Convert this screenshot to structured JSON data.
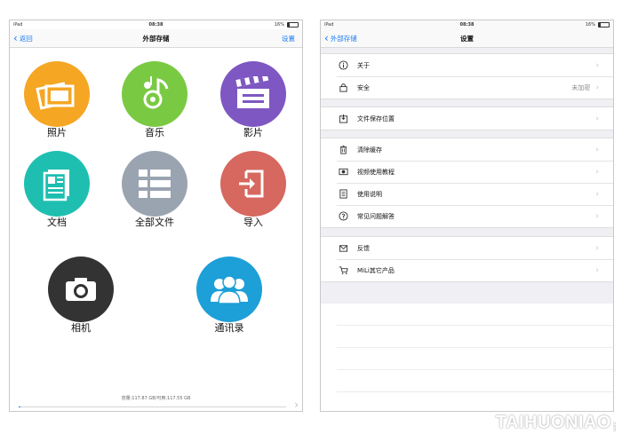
{
  "left": {
    "status": {
      "carrier": "iPad",
      "time": "08:38",
      "battery": "16%"
    },
    "nav": {
      "back": "返回",
      "title": "外部存储",
      "right": "设置"
    },
    "tiles": [
      {
        "label": "照片",
        "icon": "photos-icon",
        "color": "#f5a623"
      },
      {
        "label": "音乐",
        "icon": "music-icon",
        "color": "#7ac943"
      },
      {
        "label": "影片",
        "icon": "video-clapper-icon",
        "color": "#7e57c2"
      },
      {
        "label": "文档",
        "icon": "document-icon",
        "color": "#1ebfb0"
      },
      {
        "label": "全部文件",
        "icon": "all-files-icon",
        "color": "#9aa4b1"
      },
      {
        "label": "导入",
        "icon": "import-icon",
        "color": "#d6685f"
      },
      {
        "label": "相机",
        "icon": "camera-icon",
        "color": "#333333"
      },
      {
        "label": "通讯录",
        "icon": "contacts-icon",
        "color": "#1d9fd8"
      }
    ],
    "storage_text": "容量:117.87 GB/可用:117.55 GB",
    "storage_used_fraction": 0.003
  },
  "right": {
    "status": {
      "carrier": "iPad",
      "time": "08:38",
      "battery": "16%"
    },
    "nav": {
      "back": "外部存储",
      "title": "设置"
    },
    "groups": [
      [
        {
          "label": "关于",
          "icon": "info-icon"
        },
        {
          "label": "安全",
          "icon": "lock-icon",
          "value": "未加密"
        }
      ],
      [
        {
          "label": "文件保存位置",
          "icon": "download-tray-icon"
        }
      ],
      [
        {
          "label": "清除缓存",
          "icon": "trash-icon"
        },
        {
          "label": "视频使用教程",
          "icon": "video-tutorial-icon"
        },
        {
          "label": "使用说明",
          "icon": "manual-icon"
        },
        {
          "label": "常见问题解答",
          "icon": "question-icon"
        }
      ],
      [
        {
          "label": "反馈",
          "icon": "feedback-icon"
        },
        {
          "label": "MiLi其它产品",
          "icon": "cart-icon"
        }
      ]
    ]
  },
  "watermark": "TAIHUONIAO",
  "watermark_suffix": ".com"
}
